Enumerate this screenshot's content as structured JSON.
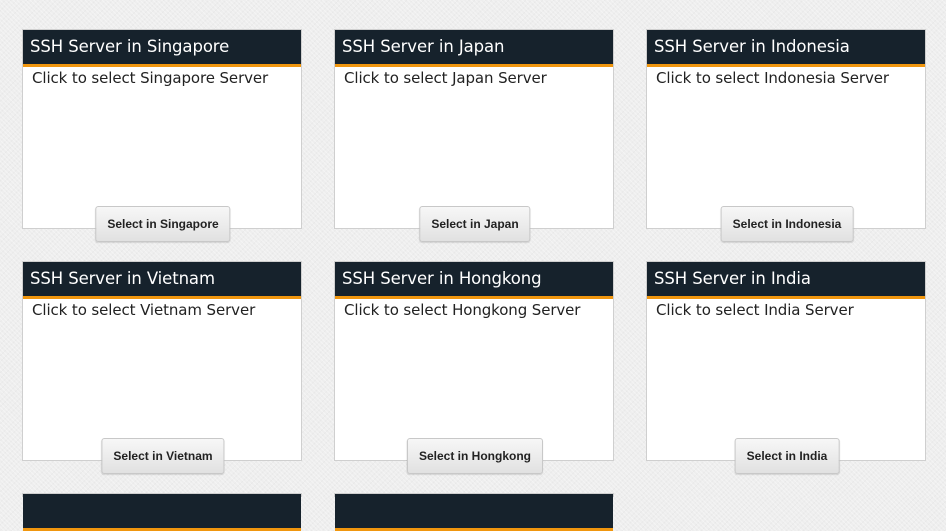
{
  "servers": [
    {
      "title": "SSH Server in Singapore",
      "description": "Click to select Singapore Server",
      "button_label": "Select in Singapore"
    },
    {
      "title": "SSH Server in Japan",
      "description": "Click to select Japan Server",
      "button_label": "Select in Japan"
    },
    {
      "title": "SSH Server in Indonesia",
      "description": "Click to select Indonesia Server",
      "button_label": "Select in Indonesia"
    },
    {
      "title": "SSH Server in Vietnam",
      "description": "Click to select Vietnam Server",
      "button_label": "Select in Vietnam"
    },
    {
      "title": "SSH Server in Hongkong",
      "description": "Click to select Hongkong Server",
      "button_label": "Select in Hongkong"
    },
    {
      "title": "SSH Server in India",
      "description": "Click to select India Server",
      "button_label": "Select in India"
    }
  ],
  "colors": {
    "header_background": "#16222c",
    "header_accent": "#f0960e",
    "card_background": "#ffffff",
    "page_background": "#eeeeee"
  }
}
